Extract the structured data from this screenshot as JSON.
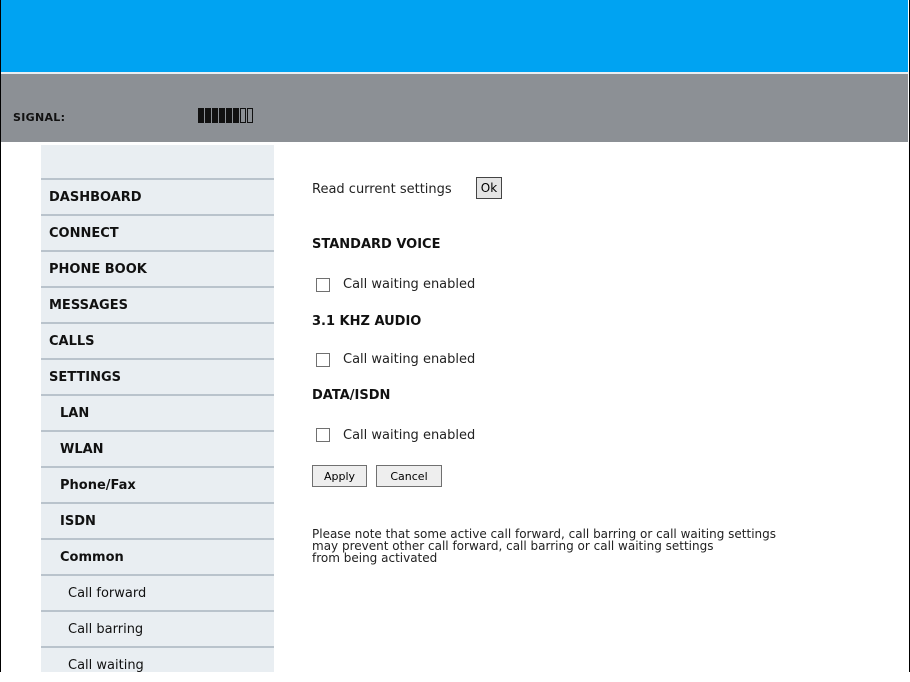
{
  "signal": {
    "label": "SIGNAL:",
    "level": 6,
    "max": 8
  },
  "sidebar": {
    "items": [
      {
        "label": "DASHBOARD"
      },
      {
        "label": "CONNECT"
      },
      {
        "label": "PHONE BOOK"
      },
      {
        "label": "MESSAGES"
      },
      {
        "label": "CALLS"
      },
      {
        "label": "SETTINGS"
      },
      {
        "label": "LAN"
      },
      {
        "label": "WLAN"
      },
      {
        "label": "Phone/Fax"
      },
      {
        "label": "ISDN"
      },
      {
        "label": "Common"
      },
      {
        "label": "Call forward"
      },
      {
        "label": "Call barring"
      },
      {
        "label": "Call waiting"
      }
    ]
  },
  "main": {
    "read_label": "Read current settings",
    "ok_label": "Ok",
    "sections": [
      {
        "heading": "STANDARD VOICE",
        "checkbox_label": "Call waiting enabled",
        "checked": false
      },
      {
        "heading": "3.1 KHZ AUDIO",
        "checkbox_label": "Call waiting enabled",
        "checked": false
      },
      {
        "heading": "DATA/ISDN",
        "checkbox_label": "Call waiting enabled",
        "checked": false
      }
    ],
    "apply_label": "Apply",
    "cancel_label": "Cancel",
    "note": [
      "Please note that some active call forward, call barring or call waiting settings",
      "may prevent other call forward, call barring or call waiting settings",
      "from being activated"
    ]
  }
}
